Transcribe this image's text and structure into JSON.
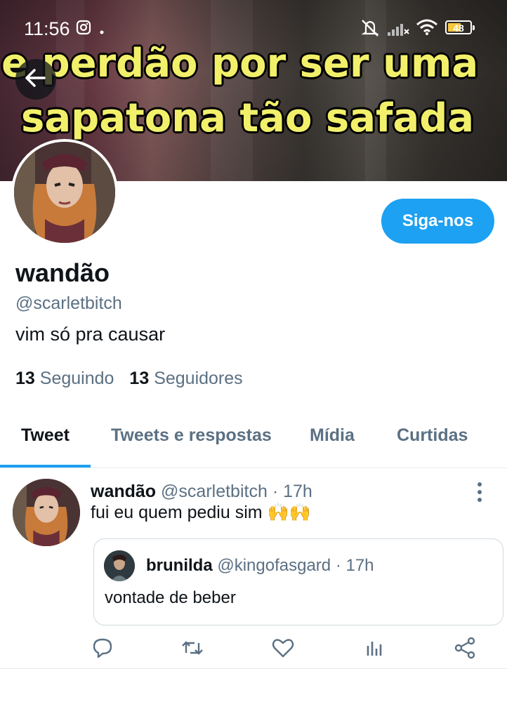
{
  "status_bar": {
    "time": "11:56",
    "battery": "48",
    "icons": [
      "instagram-icon",
      "dot-icon",
      "mute-icon",
      "signal-icon",
      "wifi-icon",
      "battery-icon"
    ]
  },
  "banner": {
    "line1": "e perdão por ser uma",
    "line2": "sapatona  tão safada",
    "text_color": "#f2f06a"
  },
  "profile": {
    "name": "wandão",
    "handle": "@scarletbitch",
    "bio": "vim só pra causar",
    "following_count": "13",
    "following_label": "Seguindo",
    "followers_count": "13",
    "followers_label": "Seguidores",
    "follow_button": "Siga-nos",
    "accent": "#1da1f2"
  },
  "tabs": [
    {
      "label": "Tweet",
      "active": true
    },
    {
      "label": "Tweets e respostas",
      "active": false
    },
    {
      "label": "Mídia",
      "active": false
    },
    {
      "label": "Curtidas",
      "active": false
    }
  ],
  "tweet": {
    "author_name": "wandão",
    "author_handle": "@scarletbitch",
    "time": "· 17h",
    "text": "fui eu quem pediu sim 🙌🙌",
    "quote": {
      "author_name": "brunilda",
      "author_handle": "@kingofasgard",
      "time": "· 17h",
      "text": "vontade de beber"
    },
    "actions": [
      "reply-icon",
      "retweet-icon",
      "like-icon",
      "analytics-icon",
      "share-icon"
    ]
  }
}
